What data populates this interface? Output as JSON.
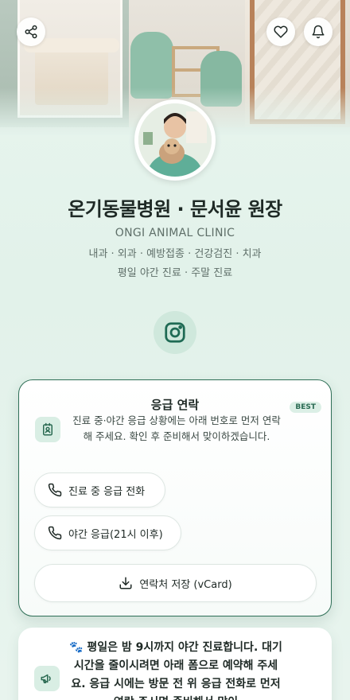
{
  "clinic": {
    "title": "온기동물병원 · 문서윤 원장",
    "subtitle": "ONGI ANIMAL CLINIC",
    "services": "내과 · 외과 · 예방접종 · 건강검진 · 치과",
    "hours": "평일 야간 진료 · 주말 진료"
  },
  "emergency_card": {
    "title": "응급 연락",
    "badge": "BEST",
    "description": "진료 중·야간 응급 상황에는 아래 번호로 먼저 연락해 주세요. 확인 후 준비해서 맞이하겠습니다.",
    "buttons": [
      {
        "label": "진료 중 응급 전화",
        "icon": "phone-icon"
      },
      {
        "label": "야간 응급(21시 이후)",
        "icon": "phone-icon"
      },
      {
        "label": "연락처 저장 (vCard)",
        "icon": "download-icon"
      }
    ]
  },
  "notice_card": {
    "text": "🐾 평일은 밤 9시까지 야간 진료합니다. 대기 시간을 줄이시려면 아래 폼으로 예약해 주세요. 응급 시에는 방문 전 위 응급 전화로 먼저 연락 주시면 준비해서 맞이",
    "icon": "megaphone-icon"
  },
  "colors": {
    "accent": "#2f6f57",
    "background": "#e4f3ec",
    "icon_bg": "#d9eee4"
  }
}
